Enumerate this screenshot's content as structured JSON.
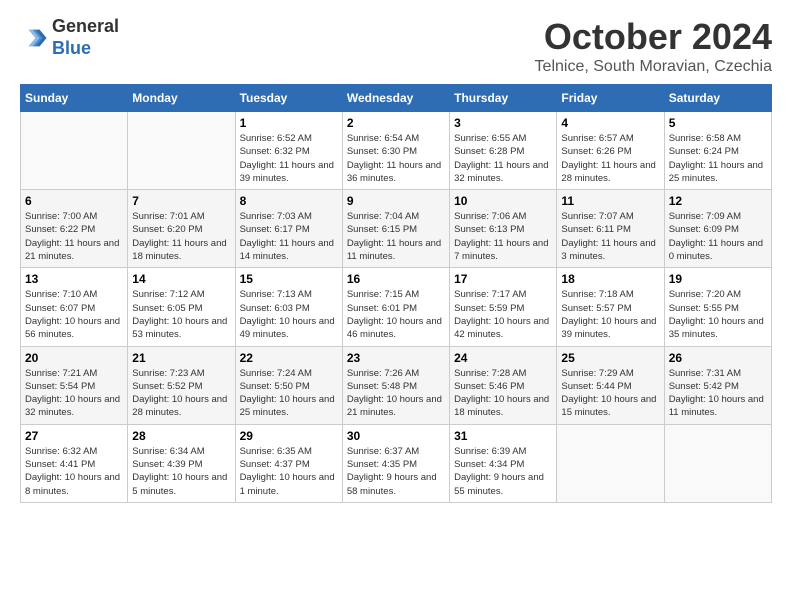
{
  "header": {
    "logo_line1": "General",
    "logo_line2": "Blue",
    "month": "October 2024",
    "location": "Telnice, South Moravian, Czechia"
  },
  "days_of_week": [
    "Sunday",
    "Monday",
    "Tuesday",
    "Wednesday",
    "Thursday",
    "Friday",
    "Saturday"
  ],
  "weeks": [
    [
      {
        "day": "",
        "info": ""
      },
      {
        "day": "",
        "info": ""
      },
      {
        "day": "1",
        "info": "Sunrise: 6:52 AM\nSunset: 6:32 PM\nDaylight: 11 hours and 39 minutes."
      },
      {
        "day": "2",
        "info": "Sunrise: 6:54 AM\nSunset: 6:30 PM\nDaylight: 11 hours and 36 minutes."
      },
      {
        "day": "3",
        "info": "Sunrise: 6:55 AM\nSunset: 6:28 PM\nDaylight: 11 hours and 32 minutes."
      },
      {
        "day": "4",
        "info": "Sunrise: 6:57 AM\nSunset: 6:26 PM\nDaylight: 11 hours and 28 minutes."
      },
      {
        "day": "5",
        "info": "Sunrise: 6:58 AM\nSunset: 6:24 PM\nDaylight: 11 hours and 25 minutes."
      }
    ],
    [
      {
        "day": "6",
        "info": "Sunrise: 7:00 AM\nSunset: 6:22 PM\nDaylight: 11 hours and 21 minutes."
      },
      {
        "day": "7",
        "info": "Sunrise: 7:01 AM\nSunset: 6:20 PM\nDaylight: 11 hours and 18 minutes."
      },
      {
        "day": "8",
        "info": "Sunrise: 7:03 AM\nSunset: 6:17 PM\nDaylight: 11 hours and 14 minutes."
      },
      {
        "day": "9",
        "info": "Sunrise: 7:04 AM\nSunset: 6:15 PM\nDaylight: 11 hours and 11 minutes."
      },
      {
        "day": "10",
        "info": "Sunrise: 7:06 AM\nSunset: 6:13 PM\nDaylight: 11 hours and 7 minutes."
      },
      {
        "day": "11",
        "info": "Sunrise: 7:07 AM\nSunset: 6:11 PM\nDaylight: 11 hours and 3 minutes."
      },
      {
        "day": "12",
        "info": "Sunrise: 7:09 AM\nSunset: 6:09 PM\nDaylight: 11 hours and 0 minutes."
      }
    ],
    [
      {
        "day": "13",
        "info": "Sunrise: 7:10 AM\nSunset: 6:07 PM\nDaylight: 10 hours and 56 minutes."
      },
      {
        "day": "14",
        "info": "Sunrise: 7:12 AM\nSunset: 6:05 PM\nDaylight: 10 hours and 53 minutes."
      },
      {
        "day": "15",
        "info": "Sunrise: 7:13 AM\nSunset: 6:03 PM\nDaylight: 10 hours and 49 minutes."
      },
      {
        "day": "16",
        "info": "Sunrise: 7:15 AM\nSunset: 6:01 PM\nDaylight: 10 hours and 46 minutes."
      },
      {
        "day": "17",
        "info": "Sunrise: 7:17 AM\nSunset: 5:59 PM\nDaylight: 10 hours and 42 minutes."
      },
      {
        "day": "18",
        "info": "Sunrise: 7:18 AM\nSunset: 5:57 PM\nDaylight: 10 hours and 39 minutes."
      },
      {
        "day": "19",
        "info": "Sunrise: 7:20 AM\nSunset: 5:55 PM\nDaylight: 10 hours and 35 minutes."
      }
    ],
    [
      {
        "day": "20",
        "info": "Sunrise: 7:21 AM\nSunset: 5:54 PM\nDaylight: 10 hours and 32 minutes."
      },
      {
        "day": "21",
        "info": "Sunrise: 7:23 AM\nSunset: 5:52 PM\nDaylight: 10 hours and 28 minutes."
      },
      {
        "day": "22",
        "info": "Sunrise: 7:24 AM\nSunset: 5:50 PM\nDaylight: 10 hours and 25 minutes."
      },
      {
        "day": "23",
        "info": "Sunrise: 7:26 AM\nSunset: 5:48 PM\nDaylight: 10 hours and 21 minutes."
      },
      {
        "day": "24",
        "info": "Sunrise: 7:28 AM\nSunset: 5:46 PM\nDaylight: 10 hours and 18 minutes."
      },
      {
        "day": "25",
        "info": "Sunrise: 7:29 AM\nSunset: 5:44 PM\nDaylight: 10 hours and 15 minutes."
      },
      {
        "day": "26",
        "info": "Sunrise: 7:31 AM\nSunset: 5:42 PM\nDaylight: 10 hours and 11 minutes."
      }
    ],
    [
      {
        "day": "27",
        "info": "Sunrise: 6:32 AM\nSunset: 4:41 PM\nDaylight: 10 hours and 8 minutes."
      },
      {
        "day": "28",
        "info": "Sunrise: 6:34 AM\nSunset: 4:39 PM\nDaylight: 10 hours and 5 minutes."
      },
      {
        "day": "29",
        "info": "Sunrise: 6:35 AM\nSunset: 4:37 PM\nDaylight: 10 hours and 1 minute."
      },
      {
        "day": "30",
        "info": "Sunrise: 6:37 AM\nSunset: 4:35 PM\nDaylight: 9 hours and 58 minutes."
      },
      {
        "day": "31",
        "info": "Sunrise: 6:39 AM\nSunset: 4:34 PM\nDaylight: 9 hours and 55 minutes."
      },
      {
        "day": "",
        "info": ""
      },
      {
        "day": "",
        "info": ""
      }
    ]
  ]
}
